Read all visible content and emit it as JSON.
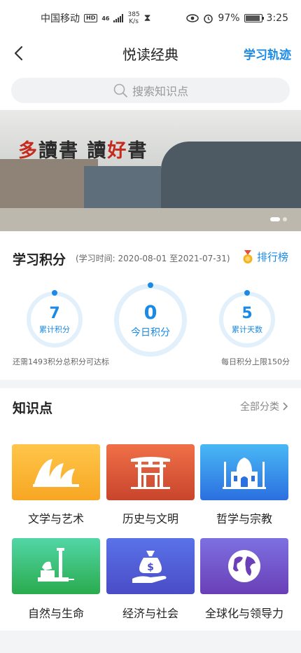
{
  "status_bar": {
    "carrier": "中国移动",
    "hd": "HD",
    "net": "46",
    "speed_value": "385",
    "speed_unit": "K/s",
    "battery": "97%",
    "time": "3:25"
  },
  "nav": {
    "title": "悦读经典",
    "right_link": "学习轨迹"
  },
  "search": {
    "placeholder": "搜索知识点"
  },
  "banner": {
    "caption_part1": "多",
    "caption_part2": "讀書  讀",
    "caption_part3": "好",
    "caption_part4": "書",
    "slide_index": 1,
    "slide_count": 2
  },
  "score": {
    "title": "学习积分",
    "period": "(学习时间: 2020-08-01 至2021-07-31)",
    "rank_label": "排行榜",
    "total_value": "7",
    "total_label": "累计积分",
    "today_value": "0",
    "today_label": "今日积分",
    "days_value": "5",
    "days_label": "累计天数",
    "note_left": "还需1493积分总积分可达标",
    "note_right": "每日积分上限150分"
  },
  "knowledge": {
    "title": "知识点",
    "all_label": "全部分类",
    "categories": [
      {
        "label": "文学与艺术",
        "icon": "opera-house-icon",
        "color_top": "#ffc64a",
        "color_bottom": "#f7a623"
      },
      {
        "label": "历史与文明",
        "icon": "torii-gate-icon",
        "color_top": "#f07048",
        "color_bottom": "#c8452c"
      },
      {
        "label": "哲学与宗教",
        "icon": "taj-mahal-icon",
        "color_top": "#49b8f5",
        "color_bottom": "#2b6fe0"
      },
      {
        "label": "自然与生命",
        "icon": "monument-icon",
        "color_top": "#52d6a6",
        "color_bottom": "#2aab4e"
      },
      {
        "label": "经济与社会",
        "icon": "money-bag-icon",
        "color_top": "#5a72e8",
        "color_bottom": "#4a4cc7"
      },
      {
        "label": "全球化与领导力",
        "icon": "globe-icon",
        "color_top": "#7d70e0",
        "color_bottom": "#6a3fb8"
      }
    ]
  },
  "colors": {
    "accent": "#1a8ae6",
    "ring": "#e2f0fc"
  }
}
